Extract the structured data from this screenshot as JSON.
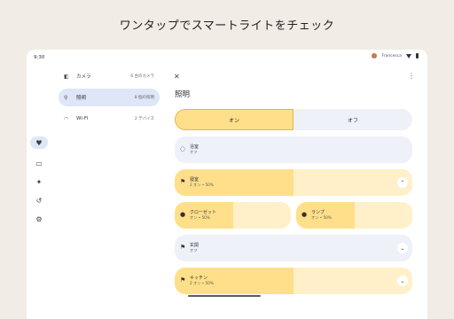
{
  "headline": "ワンタップでスマートライトをチェック",
  "status_bar": {
    "time": "9:30",
    "user": "Francesca"
  },
  "rail": {
    "items": [
      {
        "name": "favorites",
        "icon": "heart-icon",
        "glyph": "♥",
        "active": true
      },
      {
        "name": "devices",
        "icon": "devices-icon",
        "glyph": "▭",
        "active": false
      },
      {
        "name": "automations",
        "icon": "sparkle-icon",
        "glyph": "✦",
        "active": false
      },
      {
        "name": "history",
        "icon": "history-icon",
        "glyph": "↺",
        "active": false
      },
      {
        "name": "settings",
        "icon": "gear-icon",
        "glyph": "⚙",
        "active": false
      }
    ]
  },
  "rooms": [
    {
      "icon": "camera-icon",
      "glyph": "◧",
      "label": "カメラ",
      "count": "6 台のカメラ",
      "active": false
    },
    {
      "icon": "lights-icon",
      "glyph": "⚲",
      "label": "照明",
      "count": "8 個の照明",
      "active": true
    },
    {
      "icon": "wifi-icon",
      "glyph": "◠",
      "label": "Wi-Fi",
      "count": "2 デバイス",
      "active": false
    }
  ],
  "panel": {
    "close_glyph": "✕",
    "more_glyph": "⋮",
    "title": "照明",
    "toggle_on": "オン",
    "toggle_off": "オフ",
    "lights": [
      {
        "name": "浴室",
        "status": "オフ",
        "icon": "bulb-icon",
        "glyph": "◌",
        "on": false,
        "level": 0,
        "chevron": null
      },
      {
        "name": "寝室",
        "status": "2 オン • 50%",
        "icon": "light-group-icon",
        "glyph": "⚑",
        "on": true,
        "level": 0.5,
        "chevron": "⌃"
      },
      {
        "name": "クローゼット",
        "status": "オン • 50%",
        "icon": "bulb-icon",
        "glyph": "●",
        "on": true,
        "level": 0.5,
        "chevron": null
      },
      {
        "name": "ランプ",
        "status": "オン • 50%",
        "icon": "bulb-icon",
        "glyph": "●",
        "on": true,
        "level": 0.5,
        "chevron": null
      },
      {
        "name": "玄関",
        "status": "オフ",
        "icon": "light-group-icon",
        "glyph": "⚑",
        "on": false,
        "level": 0,
        "chevron": "⌄"
      },
      {
        "name": "キッチン",
        "status": "2 オン • 50%",
        "icon": "light-group-icon",
        "glyph": "⚑",
        "on": true,
        "level": 0.5,
        "chevron": "⌄"
      }
    ]
  },
  "colors": {
    "background": "#f1ede6",
    "accent_on": "#ffdf8a",
    "accent_on_track": "#fff0c9",
    "surface_off": "#eef1f8",
    "nav_active": "#dfe6f7"
  }
}
